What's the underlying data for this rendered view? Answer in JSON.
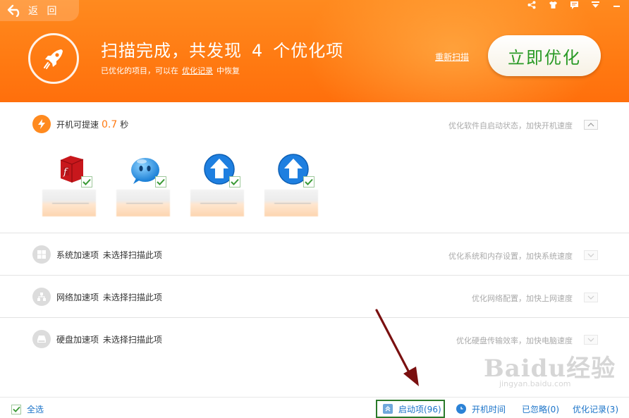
{
  "header": {
    "back_label": "返 回",
    "headline_prefix": "扫描完成，共发现",
    "headline_count": "4",
    "headline_suffix": "个优化项",
    "sub_prefix": "已优化的项目，可以在",
    "sub_link": "优化记录",
    "sub_suffix": "中恢复",
    "rescan_label": "重新扫描",
    "optimize_label": "立即优化",
    "tools": [
      "share-icon",
      "skin-icon",
      "message-icon",
      "menu-icon",
      "minimize-icon"
    ]
  },
  "startup_section": {
    "title": "开机可提速",
    "value": "0.7",
    "unit": "秒",
    "description": "优化软件自启动状态，加快开机速度",
    "apps": [
      {
        "icon": "flash-package-icon",
        "checked": true
      },
      {
        "icon": "qq-bubble-icon",
        "checked": true
      },
      {
        "icon": "upload-arrow-icon",
        "checked": true
      },
      {
        "icon": "upload-arrow-icon",
        "checked": true
      }
    ]
  },
  "sections": [
    {
      "icon": "windows-icon",
      "title": "系统加速项",
      "status": "未选择扫描此项",
      "description": "优化系统和内存设置，加快系统速度"
    },
    {
      "icon": "network-icon",
      "title": "网络加速项",
      "status": "未选择扫描此项",
      "description": "优化网络配置，加快上网速度"
    },
    {
      "icon": "disk-icon",
      "title": "硬盘加速项",
      "status": "未选择扫描此项",
      "description": "优化硬盘传输效率，加快电脑速度"
    }
  ],
  "footer": {
    "select_all": "全选",
    "startup_items": "启动项(96)",
    "boot_time": "开机时间",
    "ignored": "已忽略(0)",
    "history": "优化记录(3)"
  },
  "watermark": {
    "main": "Baidu经验",
    "sub": "jingyan.baidu.com"
  },
  "colors": {
    "header_orange": "#ff7a12",
    "accent_green": "#2a9a26",
    "link_blue": "#1a73c9",
    "highlight_box": "#2a7a2a",
    "annotation_arrow": "#7a1010"
  }
}
